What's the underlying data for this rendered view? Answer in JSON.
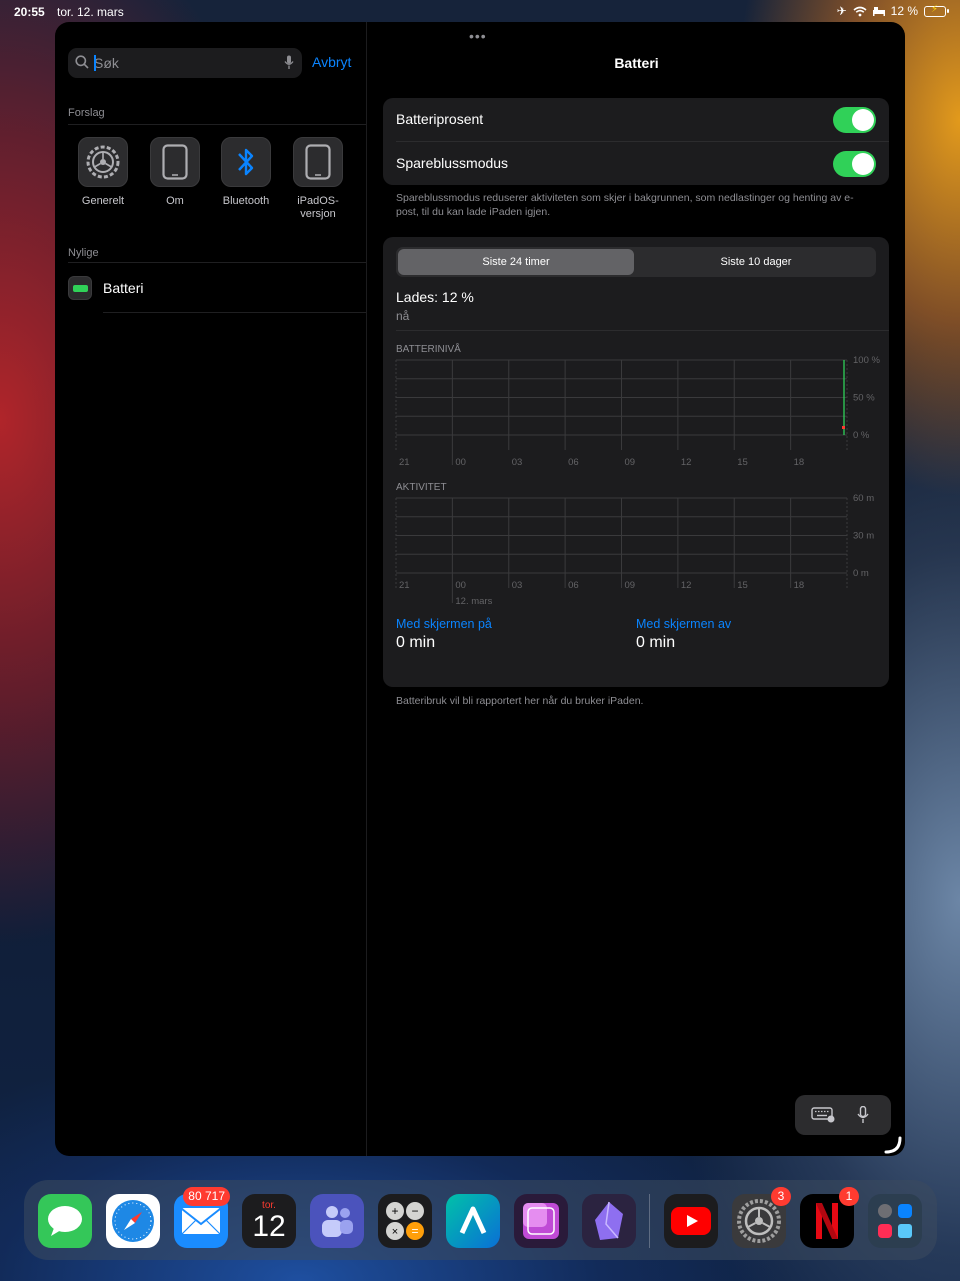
{
  "status": {
    "time": "20:55",
    "date": "tor. 12. mars",
    "battery_pct": "12 %"
  },
  "window": {
    "handle": "•••"
  },
  "sidebar": {
    "search": {
      "value": "Søk",
      "placeholder": "Søk"
    },
    "cancel_label": "Avbryt",
    "suggestions_label": "Forslag",
    "suggestions": [
      {
        "label": "Generelt",
        "icon": "gear-icon"
      },
      {
        "label": "Om",
        "icon": "ipad-icon"
      },
      {
        "label": "Bluetooth",
        "icon": "bluetooth-icon"
      },
      {
        "label": "iPadOS-versjon",
        "icon": "ipad-icon"
      }
    ],
    "recent_label": "Nylige",
    "recent": [
      {
        "label": "Batteri",
        "icon": "battery-icon"
      }
    ]
  },
  "detail": {
    "title": "Batteri",
    "toggles": [
      {
        "label": "Batteriprosent",
        "on": true
      },
      {
        "label": "Spareblussmodus",
        "on": true
      }
    ],
    "low_power_note": "Spareblussmodus reduserer aktiviteten som skjer i bakgrunnen, som nedlastinger og henting av e-post, til du kan lade iPaden igjen.",
    "segments": [
      "Siste 24 timer",
      "Siste 10 dager"
    ],
    "selected_segment": 0,
    "charging_title": "Lades: 12 %",
    "charging_sub": "nå",
    "screen_on_label": "Med skjermen på",
    "screen_on_value": "0 min",
    "screen_off_label": "Med skjermen av",
    "screen_off_value": "0 min",
    "footer_note": "Batteribruk vil bli rapportert her når du bruker iPaden."
  },
  "chart_data": [
    {
      "type": "bar",
      "title": "BATTERINIVÅ",
      "categories": [
        "21",
        "00",
        "03",
        "06",
        "09",
        "12",
        "15",
        "18"
      ],
      "y_ticks": [
        "100 %",
        "50 %",
        "0 %"
      ],
      "ylim": [
        0,
        100
      ],
      "values": [
        0,
        0,
        0,
        0,
        0,
        0,
        0,
        0
      ],
      "current_level": 12,
      "grid": true
    },
    {
      "type": "bar",
      "title": "AKTIVITET",
      "categories": [
        "21",
        "00",
        "03",
        "06",
        "09",
        "12",
        "15",
        "18"
      ],
      "sub_label": "12. mars",
      "y_ticks": [
        "60 m",
        "30 m",
        "0 m"
      ],
      "ylim": [
        0,
        60
      ],
      "values": [
        0,
        0,
        0,
        0,
        0,
        0,
        0,
        0
      ],
      "grid": true
    }
  ],
  "dock": {
    "apps": [
      {
        "name": "Meldinger",
        "icon": "messages-icon",
        "color": "#34c759"
      },
      {
        "name": "Safari",
        "icon": "safari-icon",
        "color": "#1e88e5"
      },
      {
        "name": "Mail",
        "icon": "mail-icon",
        "color": "#1a8cff",
        "badge": "80 717"
      },
      {
        "name": "Kalender",
        "icon": "calendar-icon",
        "color": "#1c1c1e",
        "day_label": "tor.",
        "day": "12"
      },
      {
        "name": "Teams",
        "icon": "teams-icon",
        "color": "#4b53bc"
      },
      {
        "name": "Kalkulator",
        "icon": "calculator-icon",
        "color": "#1c1c1e"
      },
      {
        "name": "Arc",
        "icon": "a-logo-icon",
        "color": "#0a84c6"
      },
      {
        "name": "Notatapp",
        "icon": "purple-app-icon",
        "color": "#2a1a3a"
      },
      {
        "name": "Obsidian",
        "icon": "obsidian-icon",
        "color": "#2b2340"
      },
      {
        "name": "YouTube",
        "icon": "youtube-icon",
        "color": "#1c1c1e"
      },
      {
        "name": "Innstillinger",
        "icon": "settings-icon",
        "color": "#3a3a3c",
        "badge": "3"
      },
      {
        "name": "Netflix",
        "icon": "netflix-icon",
        "color": "#000000",
        "badge": "1"
      },
      {
        "name": "Mappe",
        "icon": "app-library-icon",
        "color": "#2c3e50"
      }
    ]
  }
}
